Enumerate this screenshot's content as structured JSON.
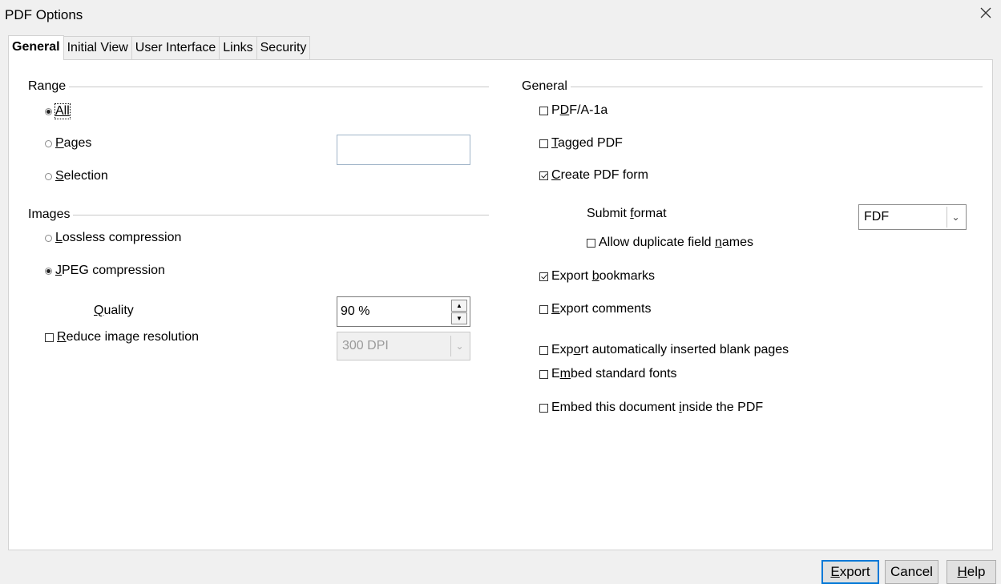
{
  "window": {
    "title": "PDF Options",
    "close_icon": "close-icon"
  },
  "tabs": [
    {
      "label": "General",
      "active": true
    },
    {
      "label": "Initial View",
      "active": false
    },
    {
      "label": "User Interface",
      "active": false
    },
    {
      "label": "Links",
      "active": false
    },
    {
      "label": "Security",
      "active": false
    }
  ],
  "range": {
    "heading": "Range",
    "all_label": "All",
    "pages_label": "Pages",
    "selection_label": "Selection",
    "selected": "All",
    "pages_value": ""
  },
  "images": {
    "heading": "Images",
    "lossless_label": "Lossless compression",
    "jpeg_label": "JPEG compression",
    "selected": "JPEG compression",
    "quality_label": "Quality",
    "quality_value": "90 %",
    "reduce_label": "Reduce image resolution",
    "reduce_checked": false,
    "resolution_value": "300 DPI"
  },
  "general": {
    "heading": "General",
    "pdfa_label": "PDF/A-1a",
    "tagged_label": "Tagged PDF",
    "create_form_label": "Create PDF form",
    "submit_format_label": "Submit format",
    "submit_format_value": "FDF",
    "allow_duplicate_label": "Allow duplicate field names",
    "export_bookmarks_label": "Export bookmarks",
    "export_comments_label": "Export comments",
    "export_blank_label": "Export automatically inserted blank pages",
    "embed_fonts_label": "Embed standard fonts",
    "embed_document_label": "Embed this document inside the PDF",
    "checked": {
      "pdfa": false,
      "tagged": false,
      "create_form": true,
      "allow_duplicate": false,
      "export_bookmarks": true,
      "export_comments": false,
      "export_blank": false,
      "embed_fonts": false,
      "embed_document": false
    }
  },
  "buttons": {
    "export": "Export",
    "cancel": "Cancel",
    "help": "Help"
  },
  "colors": {
    "default_button_border": "#0078d7",
    "panel_bg": "#ffffff",
    "window_bg": "#f0f0f0"
  }
}
